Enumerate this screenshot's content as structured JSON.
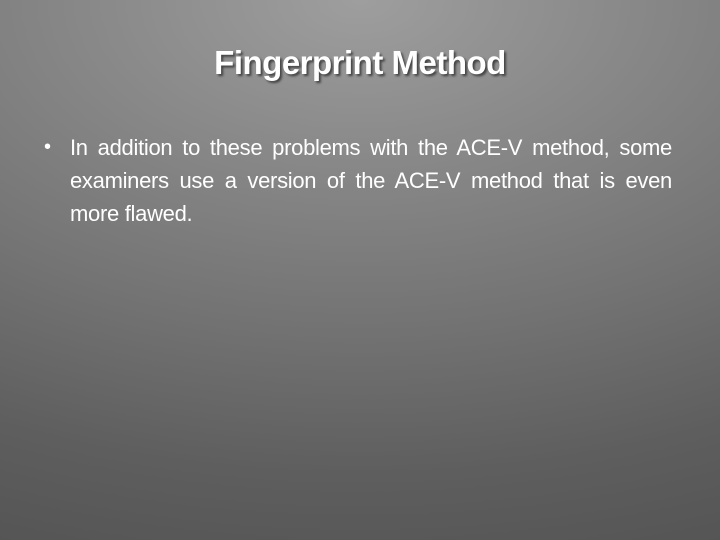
{
  "slide": {
    "title": "Fingerprint Method",
    "bullets": [
      {
        "marker": "•",
        "text": "In addition to these problems with the ACE-V method, some examiners use a version of the ACE-V method that is even more flawed."
      }
    ]
  }
}
